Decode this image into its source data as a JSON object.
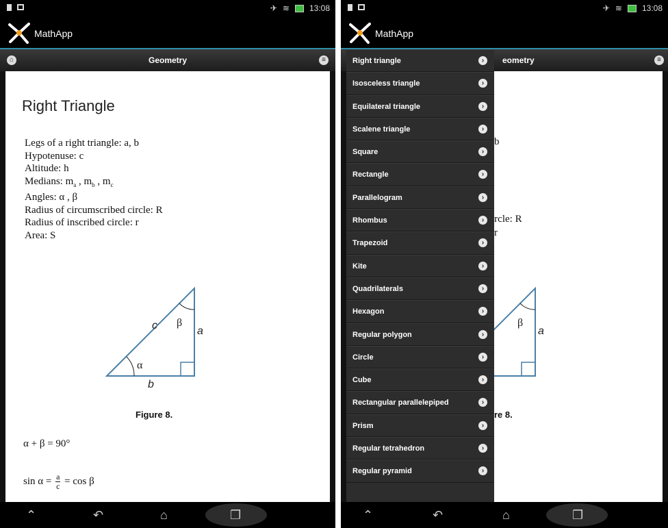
{
  "status": {
    "time": "13:08"
  },
  "app": {
    "name": "MathApp"
  },
  "nav": {
    "title": "Geometry"
  },
  "page": {
    "title": "Right Triangle",
    "definitions": [
      "Legs of a right triangle: a, b",
      "Hypotenuse: c",
      "Altitude: h",
      "Medians: m",
      "Angles: α , β",
      "Radius of circumscribed circle: R",
      "Radius of inscribed circle: r",
      "Area: S"
    ],
    "median_subs": [
      "a",
      "b",
      "c"
    ],
    "figure": {
      "caption": "Figure 8.",
      "labels": {
        "a": "a",
        "b": "b",
        "c": "c",
        "alpha": "α",
        "beta": "β"
      }
    },
    "formulas": {
      "f1": "α + β = 90°",
      "f2_left": "sin α =",
      "f2_num": "a",
      "f2_den": "c",
      "f2_right": "= cos β"
    }
  },
  "menu": {
    "items": [
      "Right triangle",
      "Isosceless triangle",
      "Equilateral triangle",
      "Scalene triangle",
      "Square",
      "Rectangle",
      "Parallelogram",
      "Rhombus",
      "Trapezoid",
      "Kite",
      "Quadrilaterals",
      "Hexagon",
      "Regular polygon",
      "Circle",
      "Cube",
      "Rectangular parallelepiped",
      "Prism",
      "Regular tetrahedron",
      "Regular pyramid"
    ]
  },
  "right_peek": {
    "nav_title": "eometry",
    "text1": "b",
    "text2": "ircle: R",
    "text3": "r",
    "caption": "re 8.",
    "label_b": "b"
  },
  "colors": {
    "accent": "#2e8fa8",
    "figure_line": "#4a7fa6"
  }
}
